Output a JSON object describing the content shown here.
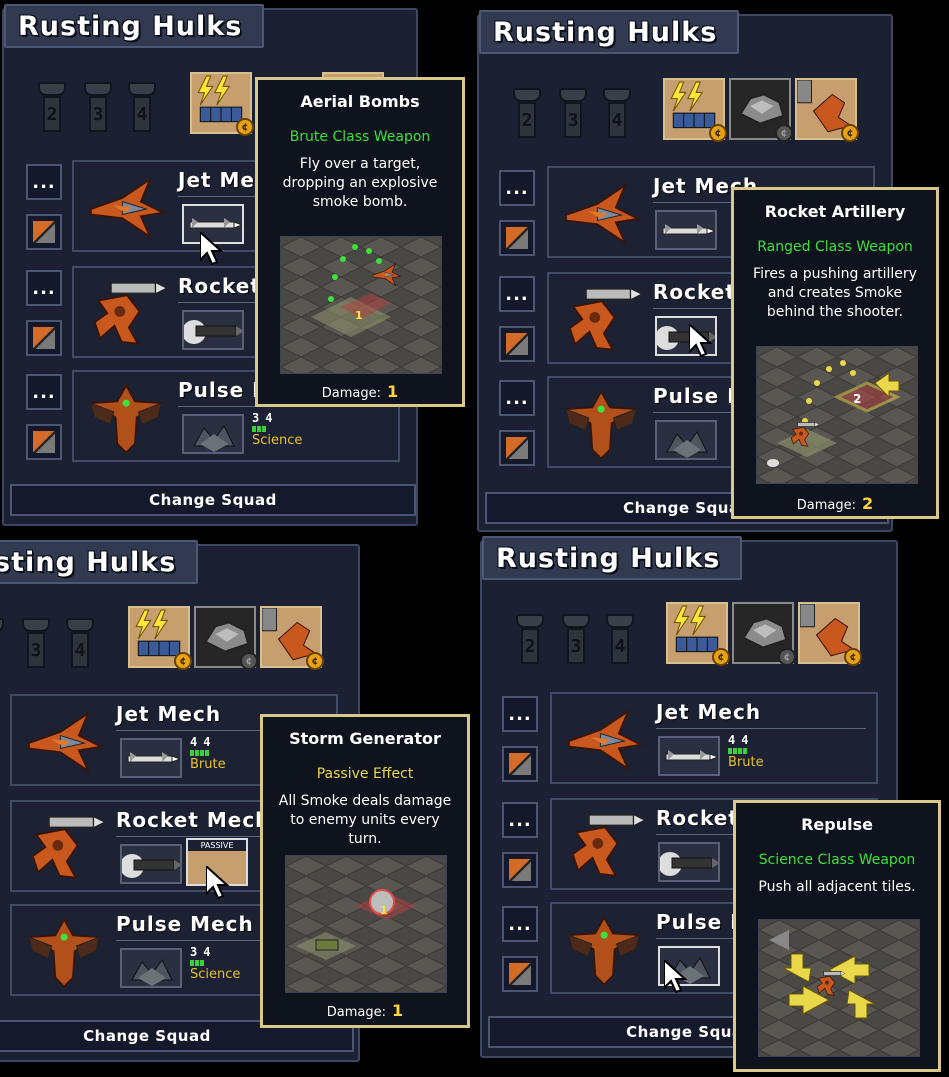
{
  "squad": {
    "title": "Rusting Hulks",
    "change_button": "Change Squad"
  },
  "slot_numbers": [
    "2",
    "3",
    "4"
  ],
  "side_button_label": "...",
  "mechs": [
    {
      "name": "Jet Mech",
      "stat_a": "4",
      "stat_b": "4",
      "class": "Brute"
    },
    {
      "name": "Rocket Mech",
      "stat_a": "",
      "stat_b": "",
      "class": ""
    },
    {
      "name": "Pulse Mech",
      "stat_a": "3",
      "stat_b": "4",
      "class": "Science"
    }
  ],
  "truncated_names": {
    "jet": "Jet Me",
    "rocket": "Rocket",
    "pulse": "Pulse M",
    "pulse_short": "Pulse N"
  },
  "passive_label": "PASSIVE",
  "tooltips": {
    "aerial": {
      "title": "Aerial Bombs",
      "class": "Brute Class Weapon",
      "desc": "Fly over a target, dropping an explosive smoke bomb.",
      "damage_label": "Damage:",
      "damage": "1"
    },
    "rocket": {
      "title": "Rocket Artillery",
      "class": "Ranged Class Weapon",
      "desc": "Fires a pushing artillery and creates Smoke behind the shooter.",
      "damage_label": "Damage:",
      "damage": "2"
    },
    "storm": {
      "title": "Storm Generator",
      "class": "Passive Effect",
      "desc": "All Smoke deals damage to enemy units every turn.",
      "damage_label": "Damage:",
      "damage": "1"
    },
    "repulse": {
      "title": "Repulse",
      "class": "Science Class Weapon",
      "desc": "Push all adjacent tiles."
    }
  },
  "colors": {
    "panel": "#1b2132",
    "border": "#3c4762",
    "tooltip_border": "#d8c88a",
    "class_green": "#3de03d",
    "damage_yellow": "#ffd43a",
    "brute_yellow": "#e8c02a"
  },
  "icons": [
    "jet-mech-icon",
    "rocket-mech-icon",
    "pulse-mech-icon",
    "missile-weapon-icon",
    "rocket-weapon-icon",
    "repulse-weapon-icon",
    "pilot-portrait-icon",
    "coin-icon",
    "cursor-arrow-icon"
  ]
}
